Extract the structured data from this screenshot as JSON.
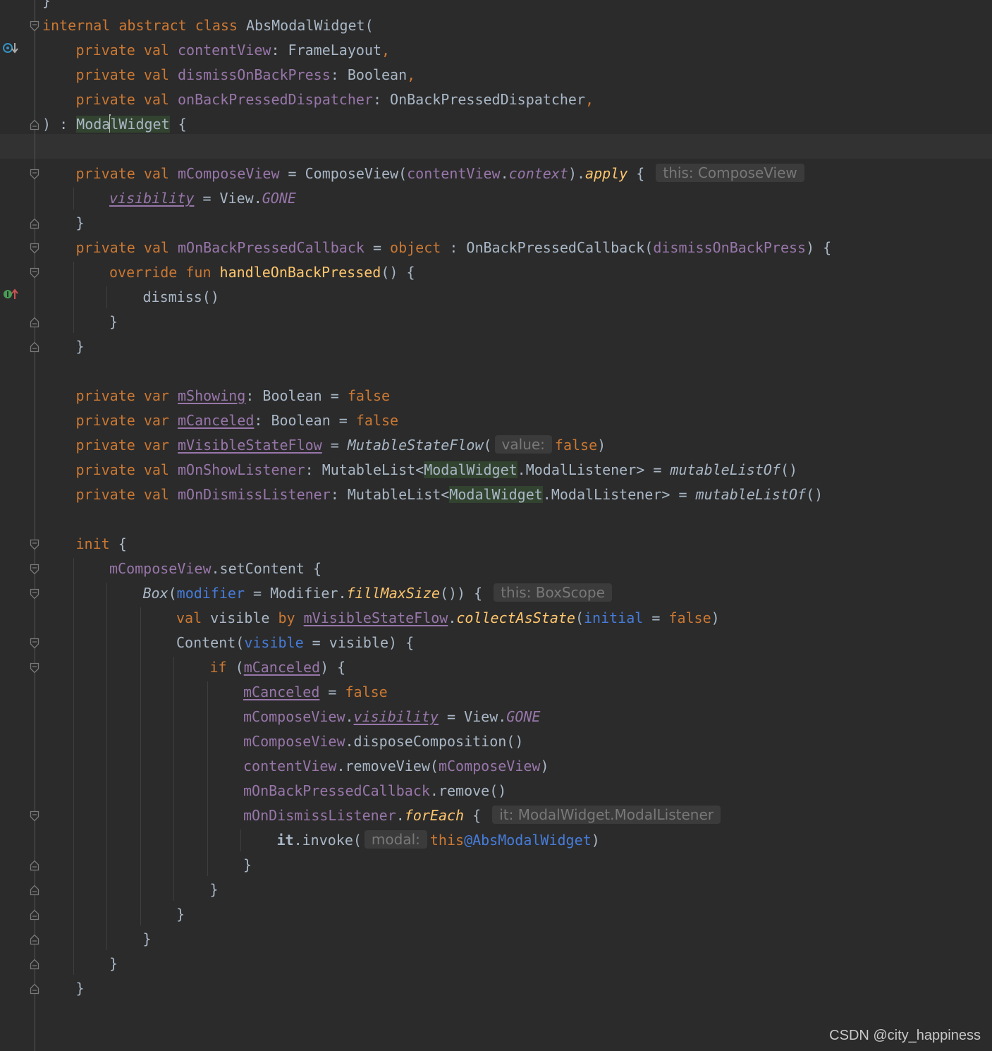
{
  "editor": {
    "watermark": "CSDN @city_happiness",
    "theme": {
      "background": "#2b2b2b",
      "default_text": "#a9b7c6",
      "keyword": "#cc7832",
      "property": "#9876aa",
      "function": "#ffc66d",
      "annotation": "#467cda",
      "hint_text": "#787878"
    },
    "gutter_icons": [
      "overriding-method-icon",
      "implementing-method-icon"
    ],
    "lines": [
      {
        "n": 0,
        "indent": 0,
        "tokens": [
          {
            "t": "}",
            "c": ""
          }
        ]
      },
      {
        "n": 1,
        "indent": 0,
        "fold": "start",
        "tokens": [
          {
            "t": "internal",
            "c": "kw"
          },
          {
            "t": " ",
            "c": ""
          },
          {
            "t": "abstract",
            "c": "kw"
          },
          {
            "t": " ",
            "c": ""
          },
          {
            "t": "class",
            "c": "kw"
          },
          {
            "t": " AbsModalWidget(",
            "c": ""
          }
        ]
      },
      {
        "n": 2,
        "indent": 1,
        "tokens": [
          {
            "t": "private",
            "c": "kw"
          },
          {
            "t": " ",
            "c": ""
          },
          {
            "t": "val",
            "c": "kw"
          },
          {
            "t": " ",
            "c": ""
          },
          {
            "t": "contentView",
            "c": "prop"
          },
          {
            "t": ": FrameLayout",
            "c": ""
          },
          {
            "t": ",",
            "c": "kw"
          }
        ]
      },
      {
        "n": 3,
        "indent": 1,
        "tokens": [
          {
            "t": "private",
            "c": "kw"
          },
          {
            "t": " ",
            "c": ""
          },
          {
            "t": "val",
            "c": "kw"
          },
          {
            "t": " ",
            "c": ""
          },
          {
            "t": "dismissOnBackPress",
            "c": "prop"
          },
          {
            "t": ": Boolean",
            "c": ""
          },
          {
            "t": ",",
            "c": "kw"
          }
        ]
      },
      {
        "n": 4,
        "indent": 1,
        "tokens": [
          {
            "t": "private",
            "c": "kw"
          },
          {
            "t": " ",
            "c": ""
          },
          {
            "t": "val",
            "c": "kw"
          },
          {
            "t": " ",
            "c": ""
          },
          {
            "t": "onBackPressedDispatcher",
            "c": "prop"
          },
          {
            "t": ": OnBackPressedDispatcher",
            "c": ""
          },
          {
            "t": ",",
            "c": "kw"
          }
        ]
      },
      {
        "n": 5,
        "indent": 0,
        "fold": "end",
        "tokens": [
          {
            "t": ") : ",
            "c": ""
          },
          {
            "t": "Moda",
            "c": "usage"
          },
          {
            "t": "|",
            "c": "caret"
          },
          {
            "t": "lWidget",
            "c": "usage"
          },
          {
            "t": " {",
            "c": ""
          }
        ]
      },
      {
        "n": 6,
        "indent": 0,
        "tokens": []
      },
      {
        "n": 7,
        "indent": 1,
        "fold": "start",
        "tokens": [
          {
            "t": "private",
            "c": "kw"
          },
          {
            "t": " ",
            "c": ""
          },
          {
            "t": "val",
            "c": "kw"
          },
          {
            "t": " ",
            "c": ""
          },
          {
            "t": "mComposeView",
            "c": "prop"
          },
          {
            "t": " = ComposeView(",
            "c": ""
          },
          {
            "t": "contentView",
            "c": "prop"
          },
          {
            "t": ".",
            "c": ""
          },
          {
            "t": "context",
            "c": "prop it"
          },
          {
            "t": ").",
            "c": ""
          },
          {
            "t": "apply",
            "c": "fn it"
          },
          {
            "t": " { ",
            "c": ""
          },
          {
            "t": "this: ComposeView",
            "c": "hint"
          }
        ]
      },
      {
        "n": 8,
        "indent": 2,
        "tokens": [
          {
            "t": "visibility",
            "c": "prop it ul"
          },
          {
            "t": " = View.",
            "c": ""
          },
          {
            "t": "GONE",
            "c": "prop it"
          }
        ]
      },
      {
        "n": 9,
        "indent": 1,
        "fold": "end",
        "tokens": [
          {
            "t": "}",
            "c": ""
          }
        ]
      },
      {
        "n": 10,
        "indent": 1,
        "fold": "start",
        "tokens": [
          {
            "t": "private",
            "c": "kw"
          },
          {
            "t": " ",
            "c": ""
          },
          {
            "t": "val",
            "c": "kw"
          },
          {
            "t": " ",
            "c": ""
          },
          {
            "t": "mOnBackPressedCallback",
            "c": "prop"
          },
          {
            "t": " = ",
            "c": ""
          },
          {
            "t": "object",
            "c": "kw"
          },
          {
            "t": " : OnBackPressedCallback(",
            "c": ""
          },
          {
            "t": "dismissOnBackPress",
            "c": "prop"
          },
          {
            "t": ") {",
            "c": ""
          }
        ]
      },
      {
        "n": 11,
        "indent": 2,
        "fold": "start",
        "icon": "implementing-method-icon",
        "tokens": [
          {
            "t": "override",
            "c": "kw"
          },
          {
            "t": " ",
            "c": ""
          },
          {
            "t": "fun",
            "c": "kw"
          },
          {
            "t": " ",
            "c": ""
          },
          {
            "t": "handleOnBackPressed",
            "c": "fn"
          },
          {
            "t": "() {",
            "c": ""
          }
        ]
      },
      {
        "n": 12,
        "indent": 3,
        "tokens": [
          {
            "t": "dismiss()",
            "c": ""
          }
        ]
      },
      {
        "n": 13,
        "indent": 2,
        "fold": "end",
        "tokens": [
          {
            "t": "}",
            "c": ""
          }
        ]
      },
      {
        "n": 14,
        "indent": 1,
        "fold": "end",
        "tokens": [
          {
            "t": "}",
            "c": ""
          }
        ]
      },
      {
        "n": 15,
        "indent": 0,
        "tokens": []
      },
      {
        "n": 16,
        "indent": 1,
        "tokens": [
          {
            "t": "private",
            "c": "kw"
          },
          {
            "t": " ",
            "c": ""
          },
          {
            "t": "var",
            "c": "kw"
          },
          {
            "t": " ",
            "c": ""
          },
          {
            "t": "mShowing",
            "c": "prop ul"
          },
          {
            "t": ": Boolean = ",
            "c": ""
          },
          {
            "t": "false",
            "c": "kw"
          }
        ]
      },
      {
        "n": 17,
        "indent": 1,
        "tokens": [
          {
            "t": "private",
            "c": "kw"
          },
          {
            "t": " ",
            "c": ""
          },
          {
            "t": "var",
            "c": "kw"
          },
          {
            "t": " ",
            "c": ""
          },
          {
            "t": "mCanceled",
            "c": "prop ul"
          },
          {
            "t": ": Boolean = ",
            "c": ""
          },
          {
            "t": "false",
            "c": "kw"
          }
        ]
      },
      {
        "n": 18,
        "indent": 1,
        "tokens": [
          {
            "t": "private",
            "c": "kw"
          },
          {
            "t": " ",
            "c": ""
          },
          {
            "t": "var",
            "c": "kw"
          },
          {
            "t": " ",
            "c": ""
          },
          {
            "t": "mVisibleStateFlow",
            "c": "prop ul"
          },
          {
            "t": " = ",
            "c": ""
          },
          {
            "t": "MutableStateFlow",
            "c": "it"
          },
          {
            "t": "(",
            "c": ""
          },
          {
            "t": "value:",
            "c": "hint"
          },
          {
            "t": "false",
            "c": "kw"
          },
          {
            "t": ")",
            "c": ""
          }
        ]
      },
      {
        "n": 19,
        "indent": 1,
        "tokens": [
          {
            "t": "private",
            "c": "kw"
          },
          {
            "t": " ",
            "c": ""
          },
          {
            "t": "val",
            "c": "kw"
          },
          {
            "t": " ",
            "c": ""
          },
          {
            "t": "mOnShowListener",
            "c": "prop"
          },
          {
            "t": ": MutableList<",
            "c": ""
          },
          {
            "t": "ModalWidget",
            "c": "usage"
          },
          {
            "t": ".ModalListener> = ",
            "c": ""
          },
          {
            "t": "mutableListOf",
            "c": "it"
          },
          {
            "t": "()",
            "c": ""
          }
        ]
      },
      {
        "n": 20,
        "indent": 1,
        "tokens": [
          {
            "t": "private",
            "c": "kw"
          },
          {
            "t": " ",
            "c": ""
          },
          {
            "t": "val",
            "c": "kw"
          },
          {
            "t": " ",
            "c": ""
          },
          {
            "t": "mOnDismissListener",
            "c": "prop"
          },
          {
            "t": ": MutableList<",
            "c": ""
          },
          {
            "t": "ModalWidget",
            "c": "usage"
          },
          {
            "t": ".ModalListener> = ",
            "c": ""
          },
          {
            "t": "mutableListOf",
            "c": "it"
          },
          {
            "t": "()",
            "c": ""
          }
        ]
      },
      {
        "n": 21,
        "indent": 0,
        "tokens": []
      },
      {
        "n": 22,
        "indent": 1,
        "fold": "start",
        "tokens": [
          {
            "t": "init",
            "c": "kw"
          },
          {
            "t": " {",
            "c": ""
          }
        ]
      },
      {
        "n": 23,
        "indent": 2,
        "fold": "start",
        "tokens": [
          {
            "t": "mComposeView",
            "c": "prop"
          },
          {
            "t": ".setContent {",
            "c": ""
          }
        ]
      },
      {
        "n": 24,
        "indent": 3,
        "fold": "start",
        "tokens": [
          {
            "t": "Box",
            "c": "it"
          },
          {
            "t": "(",
            "c": ""
          },
          {
            "t": "modifier",
            "c": "ann"
          },
          {
            "t": " = ",
            "c": ""
          },
          {
            "t": "Modifier.",
            "c": ""
          },
          {
            "t": "fillMaxSize",
            "c": "fn it"
          },
          {
            "t": "()) { ",
            "c": ""
          },
          {
            "t": "this: BoxScope",
            "c": "hint"
          }
        ]
      },
      {
        "n": 25,
        "indent": 4,
        "tokens": [
          {
            "t": "val",
            "c": "kw"
          },
          {
            "t": " visible ",
            "c": ""
          },
          {
            "t": "by",
            "c": "kw"
          },
          {
            "t": " ",
            "c": ""
          },
          {
            "t": "mVisibleStateFlow",
            "c": "prop ul"
          },
          {
            "t": ".",
            "c": ""
          },
          {
            "t": "collectAsState",
            "c": "fn it"
          },
          {
            "t": "(",
            "c": ""
          },
          {
            "t": "initial",
            "c": "ann"
          },
          {
            "t": " = ",
            "c": ""
          },
          {
            "t": "false",
            "c": "kw"
          },
          {
            "t": ")",
            "c": ""
          }
        ]
      },
      {
        "n": 26,
        "indent": 4,
        "fold": "start",
        "tokens": [
          {
            "t": "Content(",
            "c": ""
          },
          {
            "t": "visible",
            "c": "ann"
          },
          {
            "t": " = visible) {",
            "c": ""
          }
        ]
      },
      {
        "n": 27,
        "indent": 5,
        "fold": "start",
        "tokens": [
          {
            "t": "if",
            "c": "kw"
          },
          {
            "t": " (",
            "c": ""
          },
          {
            "t": "mCanceled",
            "c": "prop ul"
          },
          {
            "t": ") {",
            "c": ""
          }
        ]
      },
      {
        "n": 28,
        "indent": 6,
        "tokens": [
          {
            "t": "mCanceled",
            "c": "prop ul"
          },
          {
            "t": " = ",
            "c": ""
          },
          {
            "t": "false",
            "c": "kw"
          }
        ]
      },
      {
        "n": 29,
        "indent": 6,
        "tokens": [
          {
            "t": "mComposeView",
            "c": "prop"
          },
          {
            "t": ".",
            "c": ""
          },
          {
            "t": "visibility",
            "c": "prop it ul"
          },
          {
            "t": " = View.",
            "c": ""
          },
          {
            "t": "GONE",
            "c": "prop it"
          }
        ]
      },
      {
        "n": 30,
        "indent": 6,
        "tokens": [
          {
            "t": "mComposeView",
            "c": "prop"
          },
          {
            "t": ".disposeComposition()",
            "c": ""
          }
        ]
      },
      {
        "n": 31,
        "indent": 6,
        "tokens": [
          {
            "t": "contentView",
            "c": "prop"
          },
          {
            "t": ".removeView(",
            "c": ""
          },
          {
            "t": "mComposeView",
            "c": "prop"
          },
          {
            "t": ")",
            "c": ""
          }
        ]
      },
      {
        "n": 32,
        "indent": 6,
        "tokens": [
          {
            "t": "mOnBackPressedCallback",
            "c": "prop"
          },
          {
            "t": ".remove()",
            "c": ""
          }
        ]
      },
      {
        "n": 33,
        "indent": 6,
        "fold": "start",
        "tokens": [
          {
            "t": "mOnDismissListener",
            "c": "prop"
          },
          {
            "t": ".",
            "c": ""
          },
          {
            "t": "forEach",
            "c": "fn it"
          },
          {
            "t": " { ",
            "c": ""
          },
          {
            "t": "it: ModalWidget.ModalListener",
            "c": "hint"
          }
        ]
      },
      {
        "n": 34,
        "indent": 7,
        "tokens": [
          {
            "t": "it",
            "c": "bold"
          },
          {
            "t": ".invoke(",
            "c": ""
          },
          {
            "t": "modal:",
            "c": "hint"
          },
          {
            "t": "this",
            "c": "kw"
          },
          {
            "t": "@AbsModalWidget",
            "c": "ann"
          },
          {
            "t": ")",
            "c": ""
          }
        ]
      },
      {
        "n": 35,
        "indent": 6,
        "fold": "end",
        "tokens": [
          {
            "t": "}",
            "c": ""
          }
        ]
      },
      {
        "n": 36,
        "indent": 5,
        "fold": "end",
        "tokens": [
          {
            "t": "}",
            "c": ""
          }
        ]
      },
      {
        "n": 37,
        "indent": 4,
        "fold": "end",
        "tokens": [
          {
            "t": "}",
            "c": ""
          }
        ]
      },
      {
        "n": 38,
        "indent": 3,
        "fold": "end",
        "tokens": [
          {
            "t": "}",
            "c": ""
          }
        ]
      },
      {
        "n": 39,
        "indent": 2,
        "fold": "end",
        "tokens": [
          {
            "t": "}",
            "c": ""
          }
        ]
      },
      {
        "n": 40,
        "indent": 1,
        "fold": "end",
        "tokens": [
          {
            "t": "}",
            "c": ""
          }
        ]
      }
    ]
  }
}
